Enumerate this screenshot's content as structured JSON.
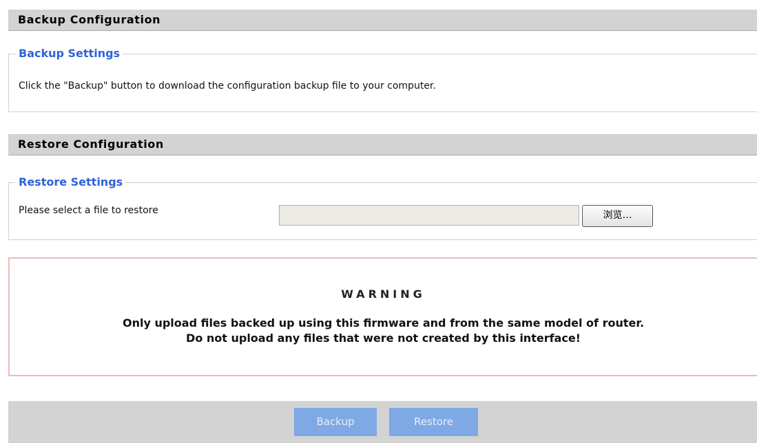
{
  "backup": {
    "header": "Backup Configuration",
    "legend": "Backup Settings",
    "description": "Click the \"Backup\" button to download the configuration backup file to your computer."
  },
  "restore": {
    "header": "Restore Configuration",
    "legend": "Restore Settings",
    "file_label": "Please select a file to restore",
    "file_value": "",
    "browse_label": "浏览…"
  },
  "warning": {
    "title": "WARNING",
    "line1": "Only upload files backed up using this firmware and from the same model of router.",
    "line2": "Do not upload any files that were not created by this interface!"
  },
  "actions": {
    "backup_label": "Backup",
    "restore_label": "Restore"
  },
  "colors": {
    "legend": "#2f62d6",
    "header_bg": "#d3d3d3",
    "warning_border": "#f0b9b9",
    "button_bg": "#7fa9e4"
  }
}
